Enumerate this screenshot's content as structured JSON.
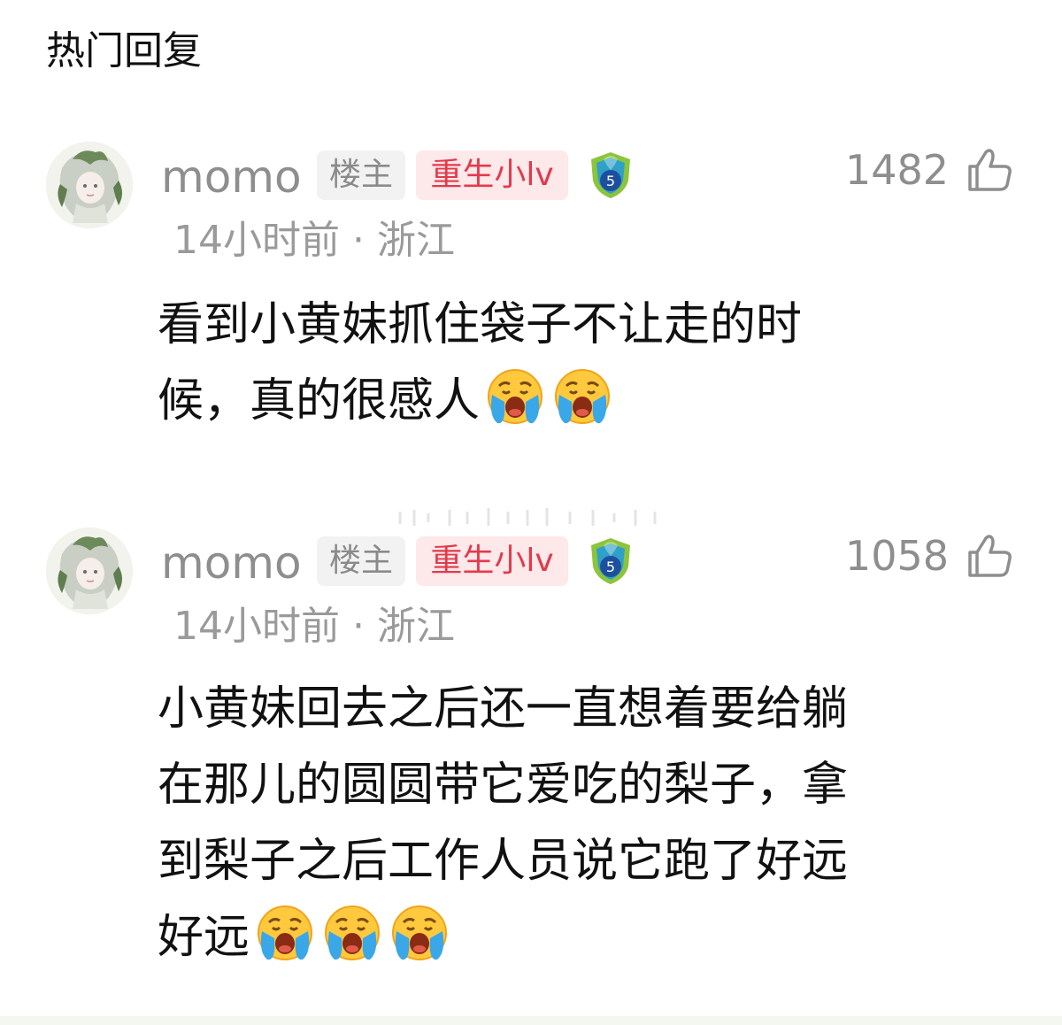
{
  "section": {
    "title": "热门回复"
  },
  "comments": [
    {
      "username": "momo",
      "tag_owner": "楼主",
      "tag_fan": "重生小lv",
      "level_badge": "5",
      "likes": "1482",
      "time": "14小时前",
      "dot": "·",
      "location": "浙江",
      "text_lines": [
        "看到小黄妹抓住袋子不让走的时",
        "候，真的很感人"
      ],
      "emojis": [
        "crying-face",
        "crying-face"
      ]
    },
    {
      "username": "momo",
      "tag_owner": "楼主",
      "tag_fan": "重生小lv",
      "level_badge": "5",
      "likes": "1058",
      "time": "14小时前",
      "dot": "·",
      "location": "浙江",
      "text_lines": [
        "小黄妹回去之后还一直想着要给躺",
        "在那儿的圆圆带它爱吃的梨子，拿",
        "到梨子之后工作人员说它跑了好远",
        "好远"
      ],
      "emojis": [
        "crying-face",
        "crying-face",
        "crying-face"
      ]
    }
  ],
  "colors": {
    "fan_tag_text": "#e23a4b",
    "fan_tag_bg": "#fde8ea",
    "muted_text": "#8e8e8e",
    "badge_blue": "#1e4f9e",
    "badge_green": "#8cc43c"
  },
  "icons": {
    "like": "thumbs-up-icon",
    "badge": "level-shield-icon",
    "emoji": "crying-face-emoji"
  }
}
